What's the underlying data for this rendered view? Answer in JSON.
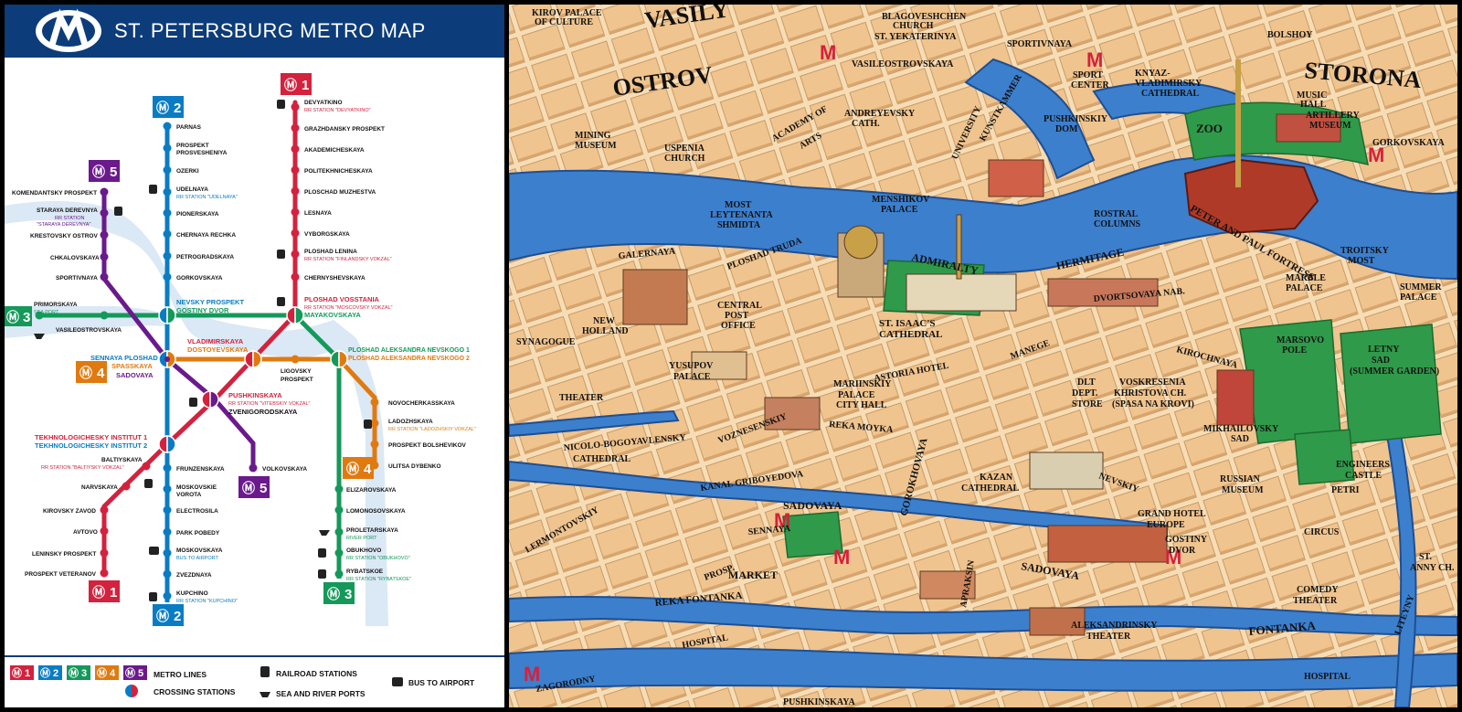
{
  "title": "ST. PETERSBURG METRO MAP",
  "colors": {
    "red": "#d4213d",
    "blue": "#0a7cc4",
    "green": "#14995a",
    "orange": "#e07a10",
    "purple": "#6a1a8c",
    "navy": "#0c3c7a",
    "water": "#5a9fe0"
  },
  "line_badges": {
    "l1": "1",
    "l2": "2",
    "l3": "3",
    "l4": "4",
    "l5": "5"
  },
  "stations": {
    "devyatkino": "DEVYATKINO",
    "devyatkino_rr": "RR STATION \"DEVYATKINO\"",
    "grazhdansky": "GRAZHDANSKY PROSPEKT",
    "akademicheskaya": "AKADEMICHESKAYA",
    "politekhnicheskaya": "POLITEKHNICHESKAYA",
    "muzhestva": "PLOSCHAD MUZHESTVA",
    "lesnaya": "LESNAYA",
    "vyborgskaya": "VYBORGSKAYA",
    "lenina": "PLOSHAD LENINA",
    "lenina_rr": "RR STATION \"FINLANDSKY VOKZAL\"",
    "chernyshevskaya": "CHERNYSHEVSKAYA",
    "vosstania": "PLOSHAD VOSSTANIA",
    "vosstania_rr": "RR STATION \"MOSCOVSKY VOKZAL\"",
    "mayakovskaya": "MAYAKOVSKAYA",
    "parnas": "PARNAS",
    "prosveshcheniya1": "PROSPEKT",
    "prosveshcheniya2": "PROSVESHENIYA",
    "ozerki": "OZERKI",
    "udelnaya": "UDELNAYA",
    "udelnaya_rr": "RR STATION \"UDELNAYA\"",
    "pionerskaya": "PIONERSKAYA",
    "chernaya": "CHERNAYA RECHKA",
    "petrogradskaya": "PETROGRADSKAYA",
    "gorkovskaya": "GORKOVSKAYA",
    "nevsky": "NEVSKY PROSPEKT",
    "gostiny": "GOSTINY DVOR",
    "komendantsky": "KOMENDANTSKY PROSPEKT",
    "staraya": "STARAYA DEREVNYA",
    "staraya_rr1": "RR STATION",
    "staraya_rr2": "\"STARAYA DEREVNYA\"",
    "krestovsky": "KRESTOVSKY OSTROV",
    "chkalovskaya": "CHKALOVSKAYA",
    "sportivnaya": "SPORTIVNAYA",
    "primorskaya": "PRIMORSKAYA",
    "primorskaya_port": "SEA PORT",
    "vasileostrovskaya": "VASILEOSTROVSKAYA",
    "sennaya": "SENNAYA PLOSHAD",
    "spasskaya": "SPASSKAYA",
    "sadovaya": "SADOVAYA",
    "vladimirskaya": "VLADIMIRSKAYA",
    "dostoyevskaya": "DOSTOYEVSKAYA",
    "ligovsky1": "LIGOVSKY",
    "ligovsky2": "PROSPEKT",
    "nevskogo1": "PLOSHAD ALEKSANDRA NEVSKOGO 1",
    "nevskogo2": "PLOSHAD ALEKSANDRA NEVSKOGO 2",
    "pushkinskaya": "PUSHKINSKAYA",
    "pushkinskaya_rr": "RR STATION \"VITEBSKIY VOKZAL\"",
    "zvenigorodskaya": "ZVENIGORODSKAYA",
    "novocherkasskaya": "NOVOCHERKASSKAYA",
    "ladozhskaya": "LADOZHSKAYA",
    "ladozhskaya_rr": "RR STATION \"LADOZHSKIY VOKZAL\"",
    "bolshevikov": "PROSPEKT BOLSHEVIKOV",
    "dybenko": "ULITSA DYBENKO",
    "techno1": "TEKHNOLOGICHESKY INSTITUT 1",
    "techno2": "TEKHNOLOGICHESKY INSTITUT 2",
    "baltiyskaya": "BALTIYSKAYA",
    "baltiyskaya_rr": "RR STATION \"BALTIYSKY VOKZAL\"",
    "narvskaya": "NARVSKAYA",
    "kirovsky": "KIROVSKY ZAVOD",
    "avtovo": "AVTOVO",
    "leninsky": "LENINSKY PROSPEKT",
    "veteranov": "PROSPEKT VETERANOV",
    "frunzenskaya": "FRUNZENSKAYA",
    "moskovskie1": "MOSKOVSKIE",
    "moskovskie2": "VOROTA",
    "electrosila": "ELECTROSILA",
    "pobedy": "PARK POBEDY",
    "moskovskaya": "MOSKOVSKAYA",
    "moskovskaya_bus": "BUS TO AIRPORT",
    "zvezdnaya": "ZVEZDNAYA",
    "kupchino": "KUPCHINO",
    "kupchino_rr": "RR STATION \"KUPCHINO\"",
    "volkovskaya": "VOLKOVSKAYA",
    "elizarovskaya": "ELIZAROVSKAYA",
    "lomonosovskaya": "LOMONOSOVSKAYA",
    "proletarskaya": "PROLETARSKAYA",
    "proletarskaya_port": "RIVER PORT",
    "obukhovo": "OBUKHOVO",
    "obukhovo_rr": "RR STATION \"OBUKHOVO\"",
    "rybatskoe": "RYBATSKOE",
    "rybatskoe_rr": "RR STATION \"RYBATSKOE\""
  },
  "legend": {
    "metro_lines": "METRO LINES",
    "railroad": "RAILROAD STATIONS",
    "bus": "BUS TO AIRPORT",
    "crossing": "CROSSING STATIONS",
    "ports": "SEA AND RIVER PORTS"
  },
  "city_labels": {
    "vasily1": "VASILY",
    "ostrov": "OSTROV",
    "storona": "STORONA",
    "palace_culture1": "KIROV PALACE",
    "palace_culture2": "OF CULTURE",
    "blagoveshchen1": "BLAGOVESHCHEN",
    "blagoveshchen2": "CHURCH",
    "yekaterinya": "ST. YEKATERINYA",
    "sportivnaya": "SPORTIVNAYA",
    "vasileostrovskaya": "VASILEOSTROVSKAYA",
    "sport_center1": "SPORT",
    "sport_center2": "CENTER",
    "knyaz1": "KNYAZ-",
    "knyaz2": "VLADIMIRSKY",
    "knyaz3": "CATHEDRAL",
    "music_hall1": "MUSIC",
    "music_hall2": "HALL",
    "artillery1": "ARTILLERY",
    "artillery2": "MUSEUM",
    "zoo": "ZOO",
    "gorkovskaya": "GORKOVSKAYA",
    "mining1": "MINING",
    "mining2": "MUSEUM",
    "uspenia1": "USPENIA",
    "uspenia2": "CHURCH",
    "andreyevsky1": "ANDREYEVSKY",
    "andreyevsky2": "CATH.",
    "academy1": "ACADEMY OF",
    "academy2": "ARTS",
    "university": "UNIVERSITY",
    "kunstkammer": "KUNSTKAMMER",
    "pushkinsky1": "PUSHKINSKIY",
    "pushkinsky2": "DOM",
    "menshikov1": "MENSHIKOV",
    "menshikov2": "PALACE",
    "rostral1": "ROSTRAL",
    "rostral2": "COLUMNS",
    "fortress": "PETER AND PAUL FORTRESS",
    "most_shmidta1": "MOST",
    "most_shmidta2": "LEYTENANTA",
    "most_shmidta3": "SHMIDTA",
    "admiralty": "ADMIRALTY",
    "hermitage": "HERMITAGE",
    "troitsky1": "TROITSKY",
    "troitsky2": "MOST",
    "marble1": "MARBLE",
    "marble2": "PALACE",
    "summer1": "SUMMER",
    "summer2": "PALACE",
    "new_holland1": "NEW",
    "new_holland2": "HOLLAND",
    "synagogue": "SYNAGOGUE",
    "post1": "CENTRAL",
    "post2": "POST",
    "post3": "OFFICE",
    "isaac1": "ST. ISAAC'S",
    "isaac2": "CATHEDRAL",
    "astoria": "ASTORIA HOTEL",
    "yusupov1": "YUSUPOV",
    "yusupov2": "PALACE",
    "theater": "THEATER",
    "mariinsky1": "MARIINSKIY",
    "mariinsky2": "PALACE",
    "mariinsky3": "CITY HALL",
    "nikolo1": "NICOLO-BOGOYAVLENSKY",
    "nikolo2": "CATHEDRAL",
    "kazan1": "KAZAN",
    "kazan2": "CATHEDRAL",
    "nevsky": "NEVSKIY",
    "dept1": "DLT",
    "dept2": "DEPT.",
    "dept3": "STORE",
    "voskresenia1": "VOSKRESENIA",
    "voskresenia2": "KHRISTOVA CH.",
    "voskresenia3": "(SPASA NA KROVI)",
    "marsovo1": "MARSOVO",
    "marsovo2": "POLE",
    "letny1": "LETNY",
    "letny2": "SAD",
    "letny3": "(SUMMER GARDEN)",
    "mikhailovsky1": "MIKHAILOVSKY",
    "mikhailovsky2": "SAD",
    "russian1": "RUSSIAN",
    "russian2": "MUSEUM",
    "engineers1": "ENGINEERS",
    "engineers2": "CASTLE",
    "grand1": "GRAND HOTEL",
    "grand2": "EUROPE",
    "gostiny1": "GOSTINY",
    "gostiny2": "DVOR",
    "circus": "CIRCUS",
    "sadovaya": "SADOVAYA",
    "sennaya": "SENNAYA",
    "market": "MARKET",
    "comedy1": "COMEDY",
    "comedy2": "THEATER",
    "anny1": "ST.",
    "anny2": "ANNY CH.",
    "aleksandrinsky1": "ALEKSANDRINSKY",
    "aleksandrinsky2": "THEATER",
    "hospital": "HOSPITAL",
    "zagorodny": "ZAGORODNY",
    "pushkinskaya": "PUSHKINSKAYA",
    "fontanka": "FONTANKA",
    "reka_fontanka": "REKA FONTANKA",
    "sadovaya_st": "SADOVAYA",
    "gorokhovaya": "GOROKHOVAYA",
    "moyka": "REKA MOYKA",
    "griboyedova": "KANAL GRIBOYEDOVA",
    "lermontovsky": "LERMONTOVSKIY",
    "voznesensky": "VOZNESENSKIY",
    "galernaya": "GALERNAYA",
    "truda": "PLOSHAD TRUDA",
    "bolshoy": "BOLSHOY",
    "liteyny": "LITEYNY",
    "prosp": "PROSP.",
    "apraksin": "APRAKSIN",
    "dvortsovaya": "DVORTSOVAYA NAB.",
    "manege": "MANEGE",
    "kirochnaya": "KIROCHNAYA",
    "petri": "PETRI"
  }
}
